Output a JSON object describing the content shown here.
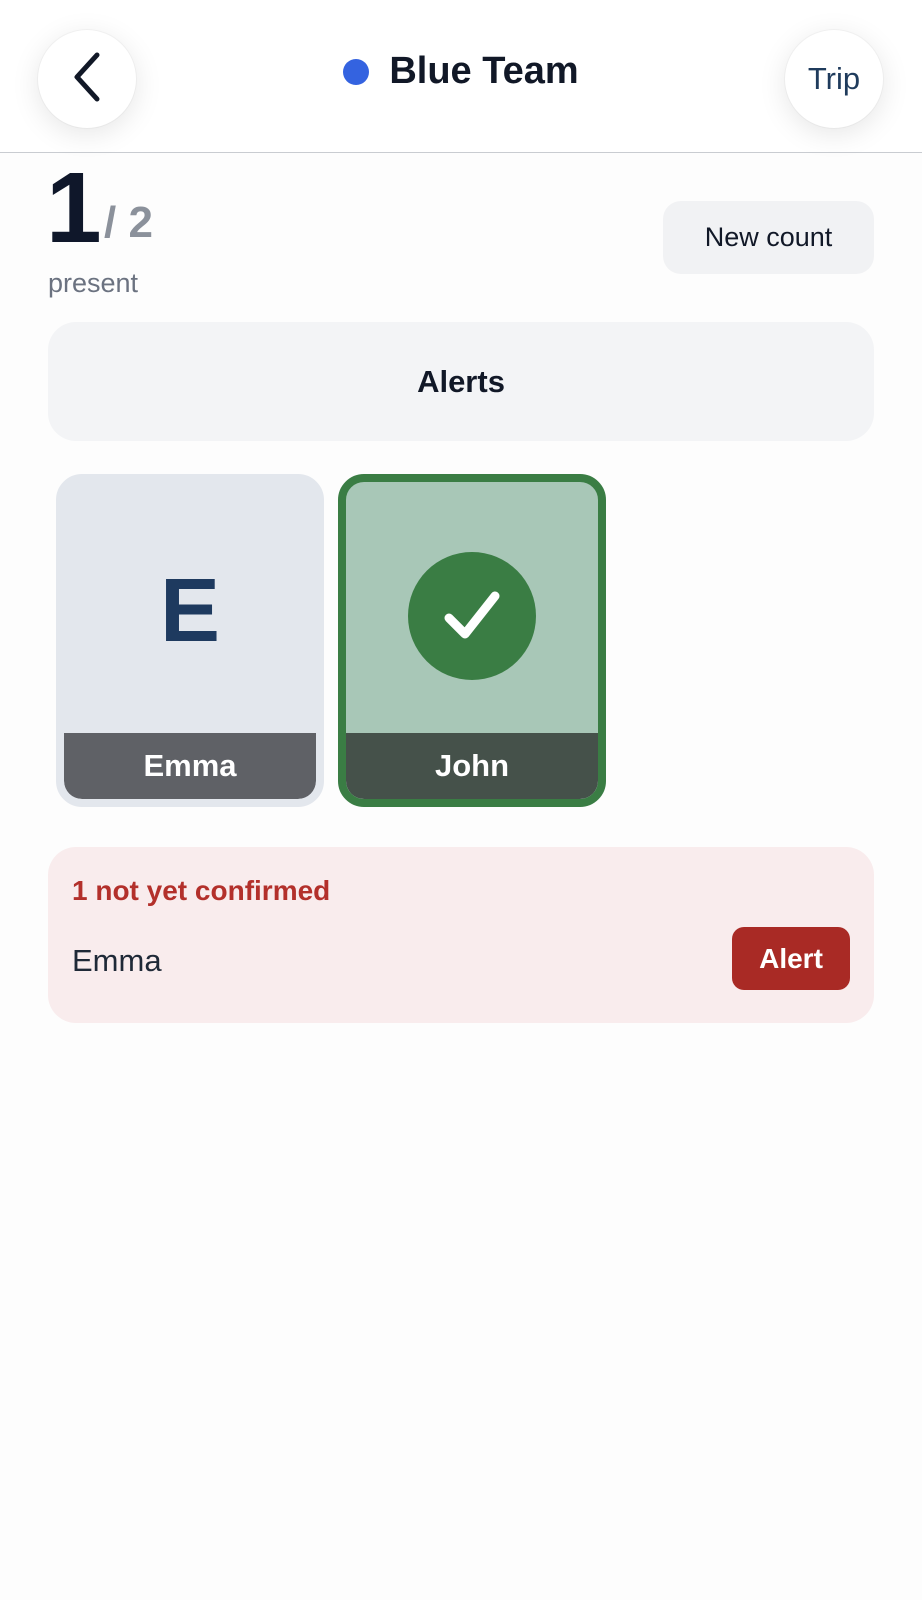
{
  "header": {
    "title": "Blue Team",
    "team_color": "#3463e0",
    "back_icon": "chevron-left-icon",
    "trip_label": "Trip"
  },
  "summary": {
    "present_count": "1",
    "total": "/ 2",
    "present_label": "present",
    "new_count_label": "New count"
  },
  "alerts_button": {
    "label": "Alerts"
  },
  "members": [
    {
      "name": "Emma",
      "initial": "E",
      "status": "unconfirmed"
    },
    {
      "name": "John",
      "status": "present",
      "icon": "checkmark-icon"
    }
  ],
  "pending": {
    "title": "1 not yet confirmed",
    "items": [
      {
        "name": "Emma",
        "action_label": "Alert"
      }
    ]
  },
  "colors": {
    "present_green": "#3a7d44",
    "alert_red": "#a92a25",
    "pending_bg": "#f9eced"
  }
}
